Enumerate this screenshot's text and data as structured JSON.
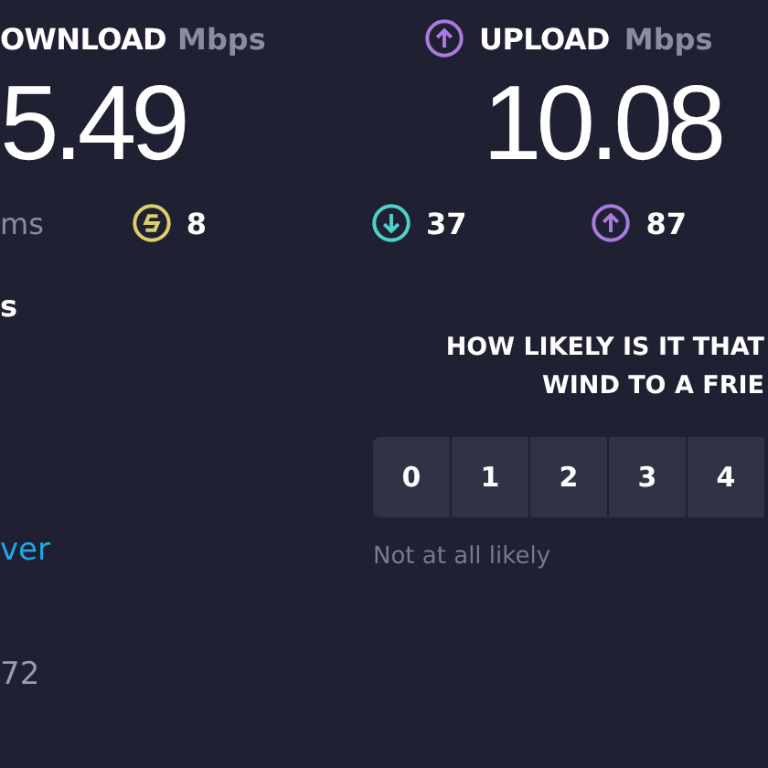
{
  "download": {
    "label": "OWNLOAD",
    "unit": "Mbps",
    "value": "5.49"
  },
  "upload": {
    "label": "UPLOAD",
    "unit": "Mbps",
    "value": "10.08"
  },
  "ping": {
    "unit": "ms"
  },
  "latency": [
    {
      "kind": "idle",
      "value": "8",
      "color": "#d8d06a"
    },
    {
      "kind": "down",
      "value": "37",
      "color": "#4fd0c8"
    },
    {
      "kind": "up",
      "value": "87",
      "color": "#a97be0"
    }
  ],
  "left_texts": {
    "heading": "s",
    "link": "ver",
    "number": "72"
  },
  "survey": {
    "question_lines": [
      "HOW LIKELY IS IT THAT",
      "WIND TO A FRIE"
    ],
    "scores": [
      "0",
      "1",
      "2",
      "3",
      "4"
    ],
    "low_label": "Not at all likely"
  }
}
